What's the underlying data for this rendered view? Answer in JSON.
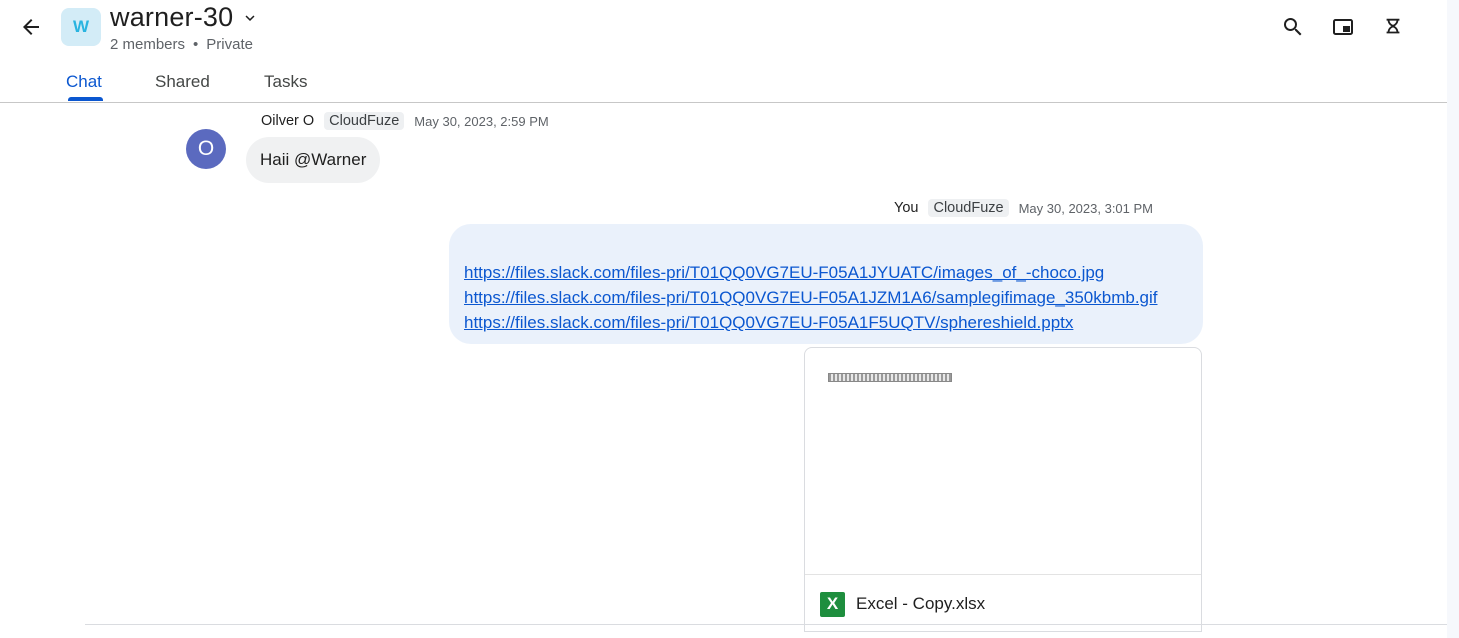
{
  "header": {
    "avatar_letter": "W",
    "space_name": "warner-30",
    "members": "2 members",
    "separator": "•",
    "privacy": "Private",
    "icons": [
      "back-arrow-icon",
      "chevron-down-icon",
      "search-icon",
      "picture-in-picture-icon",
      "hourglass-icon"
    ]
  },
  "tabs": [
    {
      "label": "Chat",
      "active": true
    },
    {
      "label": "Shared",
      "active": false
    },
    {
      "label": "Tasks",
      "active": false
    }
  ],
  "messages": [
    {
      "avatar_letter": "O",
      "sender": "Oilver O",
      "org": "CloudFuze",
      "timestamp": "May 30, 2023, 2:59 PM",
      "text": "Haii @Warner"
    },
    {
      "sender": "You",
      "org": "CloudFuze",
      "timestamp": "May 30, 2023, 3:01 PM",
      "links": [
        "https://files.slack.com/files-pri/T01QQ0VG7EU-F05A1JYUATC/images_of_-choco.jpg",
        "https://files.slack.com/files-pri/T01QQ0VG7EU-F05A1JZM1A6/samplegifimage_350kbmb.gif",
        "https://files.slack.com/files-pri/T01QQ0VG7EU-F05A1F5UQTV/sphereshield.pptx"
      ],
      "attachment": {
        "icon_letter": "X",
        "name": "Excel - Copy.xlsx"
      }
    }
  ],
  "colors": {
    "accent": "#0b57d0",
    "outgoing_bubble": "#eaf1fb",
    "incoming_bubble": "#f0f1f2",
    "user_avatar": "#5b6abf",
    "excel_green": "#1e8e3e"
  }
}
